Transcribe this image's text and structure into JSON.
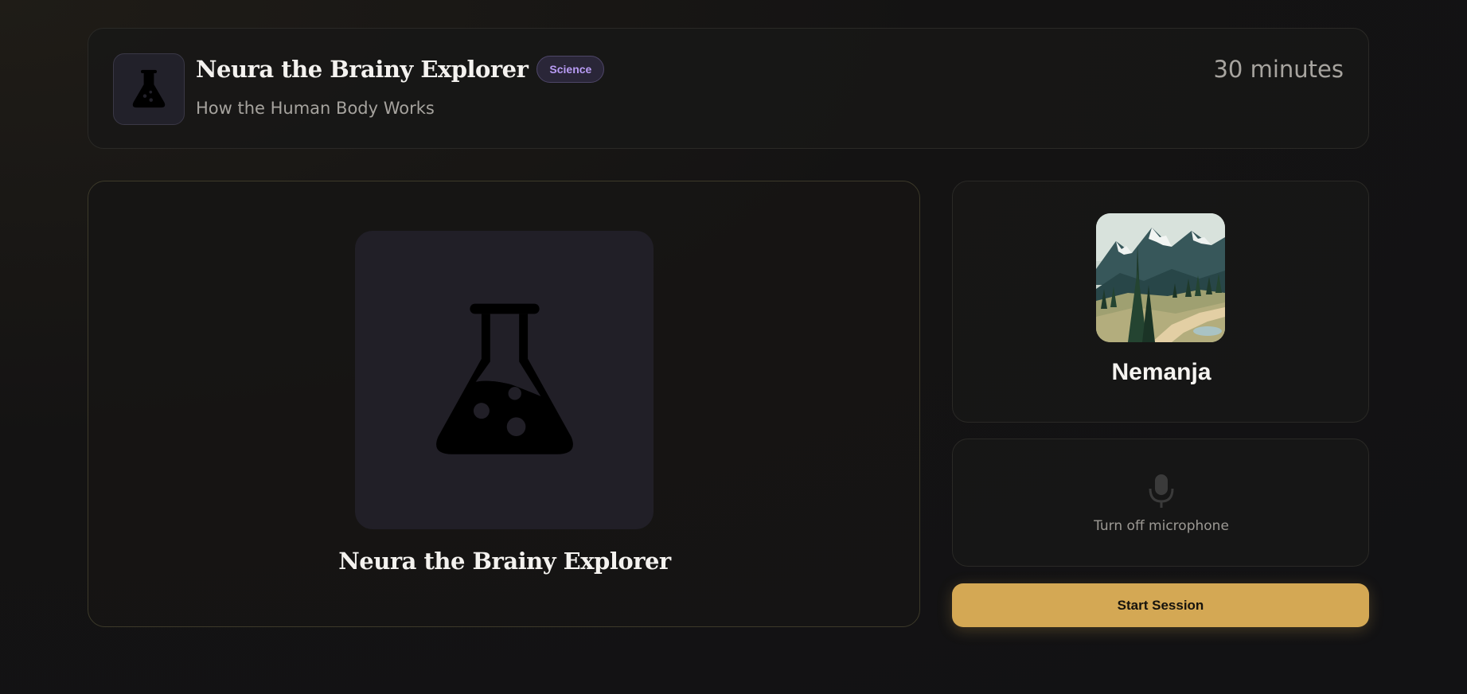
{
  "header": {
    "title": "Neura the Brainy Explorer",
    "subject_badge": "Science",
    "topic": "How the Human Body Works",
    "duration": "30 minutes",
    "icon": "flask-icon"
  },
  "companion": {
    "name": "Neura the Brainy Explorer",
    "icon": "flask-icon"
  },
  "user": {
    "name": "Nemanja",
    "avatar": "mountain-landscape-avatar"
  },
  "microphone": {
    "label": "Turn off microphone",
    "icon": "microphone-icon"
  },
  "session": {
    "start_label": "Start Session"
  },
  "colors": {
    "accent": "#d4a854",
    "badge_text": "#b99cf5",
    "background": "#141313"
  }
}
